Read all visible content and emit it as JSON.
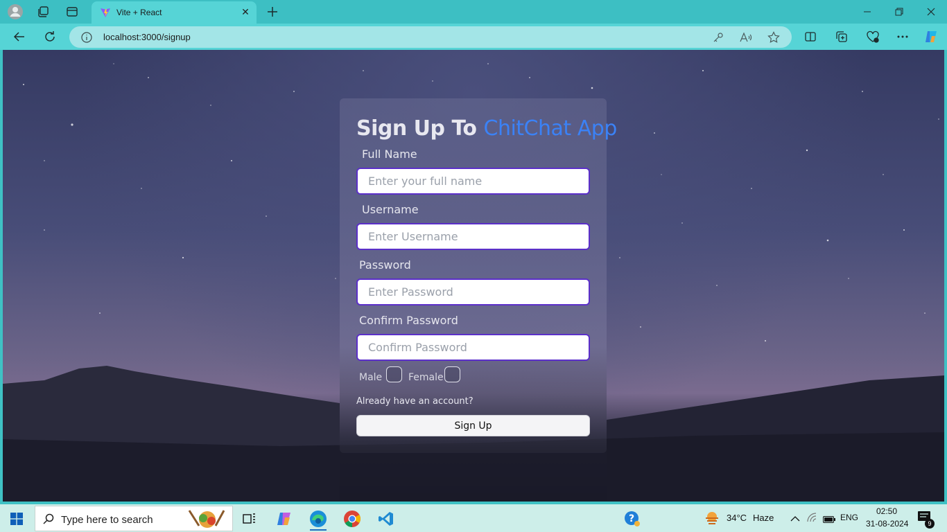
{
  "browser": {
    "tab_title": "Vite + React",
    "url": "localhost:3000/signup"
  },
  "signup": {
    "title_prefix": "Sign Up To",
    "title_brand": "ChitChat App",
    "brand_color": "#3b82f6",
    "fullname_label": "Full Name",
    "fullname_placeholder": "Enter your full name",
    "username_label": "Username",
    "username_placeholder": "Enter Username",
    "password_label": "Password",
    "password_placeholder": "Enter Password",
    "confirm_label": "Confirm Password",
    "confirm_placeholder": "Confirm Password",
    "male_label": "Male",
    "female_label": "Female",
    "login_link": "Already have an account?",
    "submit_label": "Sign Up"
  },
  "taskbar": {
    "search_placeholder": "Type here to search",
    "weather_temp": "34°C",
    "weather_desc": "Haze",
    "language": "ENG",
    "time": "02:50",
    "date": "31-08-2024",
    "notification_count": "9"
  }
}
